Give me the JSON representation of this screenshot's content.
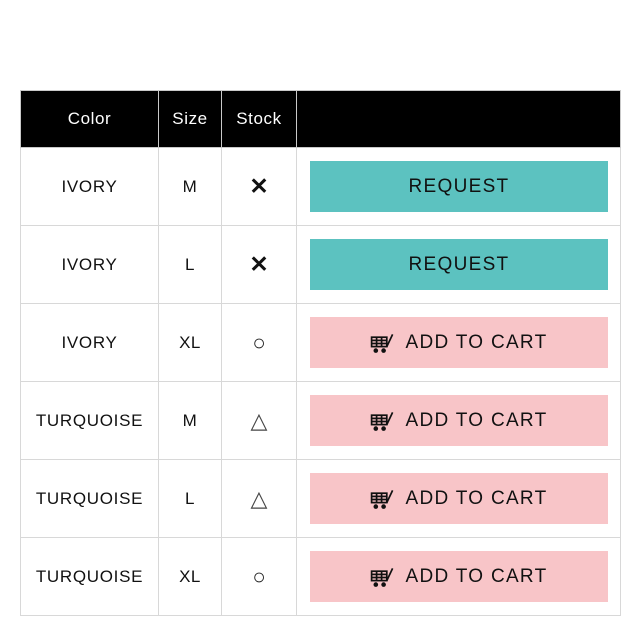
{
  "table": {
    "headers": [
      {
        "label": "Color",
        "name": "column-header-color"
      },
      {
        "label": "Size",
        "name": "column-header-size"
      },
      {
        "label": "Stock",
        "name": "column-header-stock"
      },
      {
        "label": "",
        "name": "column-header-action"
      }
    ],
    "rows": [
      {
        "color": "IVORY",
        "size": "M",
        "stock_symbol": "✕",
        "stock_state": "out-of-stock",
        "action_label": "REQUEST",
        "action_type": "request",
        "has_cart_icon": false
      },
      {
        "color": "IVORY",
        "size": "L",
        "stock_symbol": "✕",
        "stock_state": "out-of-stock",
        "action_label": "REQUEST",
        "action_type": "request",
        "has_cart_icon": false
      },
      {
        "color": "IVORY",
        "size": "XL",
        "stock_symbol": "○",
        "stock_state": "in-stock",
        "action_label": "ADD TO CART",
        "action_type": "add-to-cart",
        "has_cart_icon": true
      },
      {
        "color": "TURQUOISE",
        "size": "M",
        "stock_symbol": "△",
        "stock_state": "low-stock",
        "action_label": "ADD TO CART",
        "action_type": "add-to-cart",
        "has_cart_icon": true
      },
      {
        "color": "TURQUOISE",
        "size": "L",
        "stock_symbol": "△",
        "stock_state": "low-stock",
        "action_label": "ADD TO CART",
        "action_type": "add-to-cart",
        "has_cart_icon": true
      },
      {
        "color": "TURQUOISE",
        "size": "XL",
        "stock_symbol": "○",
        "stock_state": "in-stock",
        "action_label": "ADD TO CART",
        "action_type": "add-to-cart",
        "has_cart_icon": true
      }
    ]
  },
  "colors": {
    "header_background": "#000000",
    "header_text": "#ffffff",
    "request_button": "#5cc2c0",
    "cart_button": "#f8c5c8",
    "button_text": "#111111",
    "page_background": "#ffffff",
    "cell_border": "#d8d8d8"
  },
  "icons": {
    "cart": "shopping-cart-icon"
  }
}
